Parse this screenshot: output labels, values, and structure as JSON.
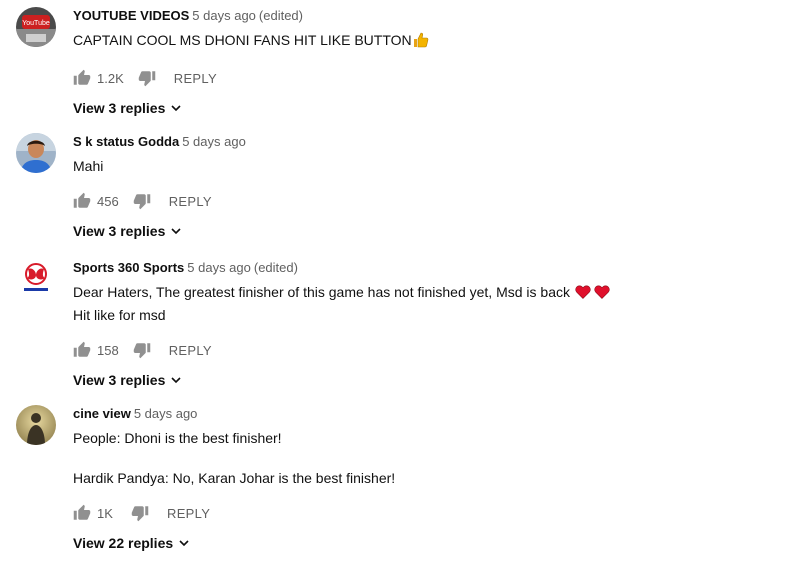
{
  "comments": [
    {
      "author": "YOUTUBE VIDEOS",
      "time": "5 days ago",
      "edited": "(edited)",
      "text": "CAPTAIN COOL MS DHONI FANS HIT LIKE BUTTON",
      "emoji": "thumbs-up-emoji",
      "likes": "1.2K",
      "reply": "REPLY",
      "view_replies": "View 3 replies",
      "avatar_text": "YouTube",
      "avatar_icon": "youtube-logo-avatar"
    },
    {
      "author": "S k status Godda",
      "time": "5 days ago",
      "edited": "",
      "text": "Mahi",
      "likes": "456",
      "reply": "REPLY",
      "view_replies": "View 3 replies",
      "avatar_icon": "person-photo-avatar"
    },
    {
      "author": "Sports 360 Sports",
      "time": "5 days ago",
      "edited": "(edited)",
      "text_line1": "Dear Haters, The greatest finisher of this game has not finished yet, Msd is back",
      "emoji": "red-heart-emoji",
      "text_line2": "Hit like for msd",
      "likes": "158",
      "reply": "REPLY",
      "view_replies": "View 3 replies",
      "avatar_icon": "sports-logo-avatar"
    },
    {
      "author": "cine view",
      "time": "5 days ago",
      "edited": "",
      "text_line1": "People: Dhoni is the best finisher!",
      "text_line2": "Hardik Pandya: No, Karan Johar is the best finisher!",
      "likes": "1K",
      "reply": "REPLY",
      "view_replies": "View 22 replies",
      "avatar_icon": "silhouette-photo-avatar"
    }
  ],
  "icons": {
    "like": "thumbs-up-icon",
    "dislike": "thumbs-down-icon",
    "expand": "chevron-down-icon"
  },
  "colors": {
    "secondary_text": "#606060",
    "primary_text": "#0f0f0f",
    "heart": "#e0102c"
  }
}
